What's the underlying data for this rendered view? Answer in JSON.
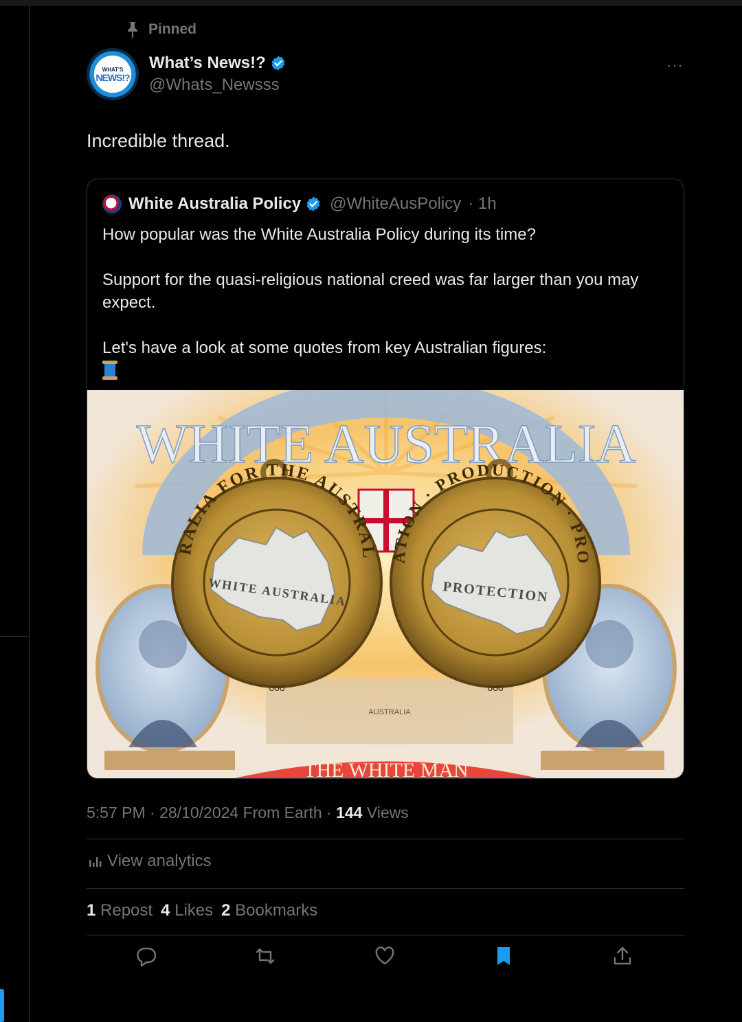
{
  "pinned_label": "Pinned",
  "author": {
    "name": "What’s News!?",
    "handle": "@Whats_Newsss",
    "avatar_top": "WHAT'S",
    "avatar_main": "NEWS!?"
  },
  "more_label": "···",
  "tweet_text": "Incredible thread.",
  "quote": {
    "name": "White Australia Policy",
    "handle": "@WhiteAusPolicy",
    "time": "· 1h",
    "line1": "How popular was the White Australia Policy during its time?",
    "line2": "Support for the quasi-religious national creed was far larger than you may expect.",
    "line3": "Let's have a look at some quotes from key Australian figures:",
    "media": {
      "poster_top": "WHITE AUSTRALIA",
      "poster_bottom": "THE WHITE MAN",
      "poster_map": "AUSTRALIA",
      "medal_left_ring": "AUSTRALIA FOR THE AUSTRALIANS",
      "medal_left_center": "WHITE AUSTRALIA",
      "medal_right_ring": "POPULATION · PRODUCTION · PROGRESS",
      "medal_right_center": "PROTECTION"
    }
  },
  "meta": {
    "time": "5:57 PM",
    "date": "· 28/10/2024 From Earth ·",
    "views_count": "144",
    "views_label": "Views"
  },
  "analytics_label": "View analytics",
  "stats": {
    "reposts_count": "1",
    "reposts_label": "Repost",
    "likes_count": "4",
    "likes_label": "Likes",
    "bookmarks_count": "2",
    "bookmarks_label": "Bookmarks"
  },
  "colors": {
    "background": "#000000",
    "text_primary": "#e7e9ea",
    "text_secondary": "#71767b",
    "accent": "#1d9bf0",
    "border": "#2f3336"
  }
}
